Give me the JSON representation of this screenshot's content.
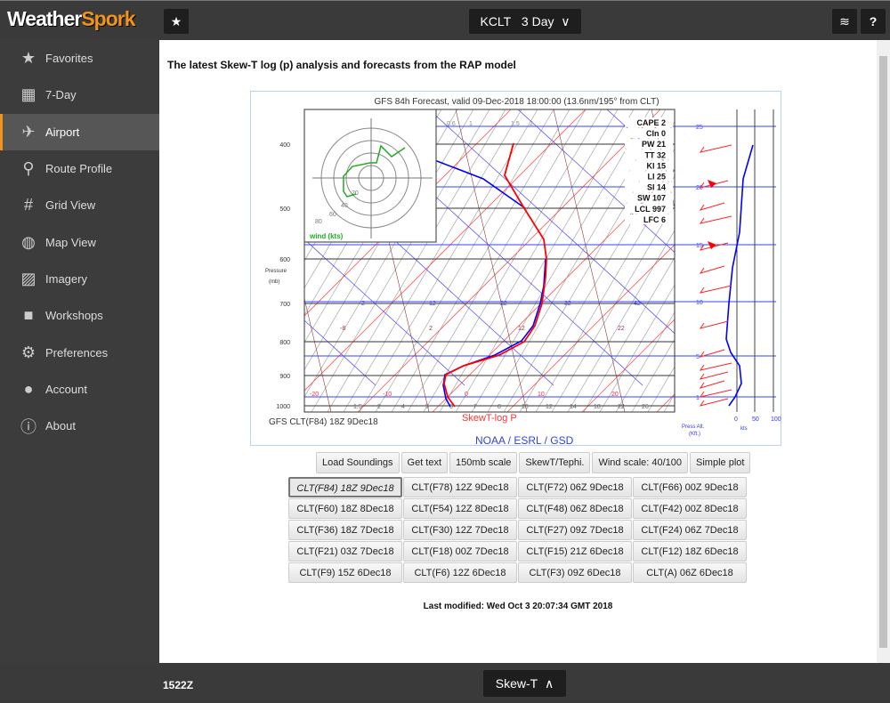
{
  "app": {
    "logo_a": "Weather",
    "logo_b": "Spork"
  },
  "topbar": {
    "station": "KCLT",
    "period": "3 Day",
    "favorite_icon": "star-icon",
    "layers_icon": "layers-icon",
    "help_icon": "help-icon"
  },
  "sidebar": {
    "items": [
      {
        "label": "Favorites",
        "icon": "star-icon",
        "glyph": "★"
      },
      {
        "label": "7-Day",
        "icon": "calendar-icon",
        "glyph": "▦"
      },
      {
        "label": "Airport",
        "icon": "plane-icon",
        "glyph": "✈",
        "active": true
      },
      {
        "label": "Route Profile",
        "icon": "route-icon",
        "glyph": "⚲"
      },
      {
        "label": "Grid View",
        "icon": "hash-icon",
        "glyph": "#"
      },
      {
        "label": "Map View",
        "icon": "globe-icon",
        "glyph": "◍"
      },
      {
        "label": "Imagery",
        "icon": "image-icon",
        "glyph": "▨"
      },
      {
        "label": "Workshops",
        "icon": "video-icon",
        "glyph": "■"
      },
      {
        "label": "Preferences",
        "icon": "gear-icon",
        "glyph": "⚙"
      },
      {
        "label": "Account",
        "icon": "user-icon",
        "glyph": "●"
      },
      {
        "label": "About",
        "icon": "info-icon",
        "glyph": "ⓘ"
      }
    ]
  },
  "main": {
    "heading": "The latest Skew-T log (p) analysis and forecasts from the RAP model",
    "plot": {
      "title": "GFS 84h Forecast, valid 09-Dec-2018 18:00:00 (13.6nm/195° from CLT)",
      "pressure_label": "Pressure",
      "pressure_unit": "(mb)",
      "pressure_ticks": [
        "400",
        "500",
        "600",
        "700",
        "800",
        "900",
        "1000"
      ],
      "stats": [
        "CAPE 2",
        "CIn 0",
        "PW 21",
        "TT 32",
        "KI 15",
        "LI 25",
        "SI 14",
        "SW 107",
        "LCL 997",
        "LFC 6"
      ],
      "hodo_label": "wind (kts)",
      "hodo_rings": [
        "20",
        "40",
        "60",
        "80"
      ],
      "mixing_ratio_ticks": [
        "0.4",
        "0.6",
        "1",
        "1.5",
        "2"
      ],
      "bottom_mix_ticks": [
        "1.5",
        "2",
        "4",
        "5",
        "6",
        "7",
        "8",
        "10",
        "12",
        "14",
        "18",
        "22",
        "26"
      ],
      "isotherm_labels": [
        "-20",
        "-10",
        "0",
        "10",
        "20"
      ],
      "theta_e_labels": [
        "2",
        "12",
        "22",
        "32",
        "42"
      ],
      "adiabat_labels": [
        "-8",
        "2",
        "12",
        "22"
      ],
      "alt_ticks": [
        "25",
        "20",
        "15",
        "10",
        "5",
        "1"
      ],
      "alt_label": "Press Alt.",
      "alt_unit": "(Kft.)",
      "speed_ticks": [
        "0",
        "50",
        "100"
      ],
      "speed_unit": "kts",
      "station_caption": "GFS CLT(F84) 18Z 9Dec18",
      "chart_kind": "SkewT-log P",
      "credit": "NOAA / ESRL / GSD",
      "colors": {
        "temperature": "#ff0000",
        "dewpoint": "#0000ff",
        "hodograph": "#00aa00"
      }
    },
    "controls": [
      "Load Soundings",
      "Get text",
      "150mb scale",
      "SkewT/Tephi.",
      "Wind scale: 40/100",
      "Simple plot"
    ],
    "soundings": [
      "CLT(F84) 18Z 9Dec18",
      "CLT(F78) 12Z 9Dec18",
      "CLT(F72) 06Z 9Dec18",
      "CLT(F66) 00Z 9Dec18",
      "CLT(F60) 18Z 8Dec18",
      "CLT(F54) 12Z 8Dec18",
      "CLT(F48) 06Z 8Dec18",
      "CLT(F42) 00Z 8Dec18",
      "CLT(F36) 18Z 7Dec18",
      "CLT(F30) 12Z 7Dec18",
      "CLT(F27) 09Z 7Dec18",
      "CLT(F24) 06Z 7Dec18",
      "CLT(F21) 03Z 7Dec18",
      "CLT(F18) 00Z 7Dec18",
      "CLT(F15) 21Z 6Dec18",
      "CLT(F12) 18Z 6Dec18",
      "CLT(F9) 15Z 6Dec18",
      "CLT(F6) 12Z 6Dec18",
      "CLT(F3) 09Z 6Dec18",
      "CLT(A) 06Z 6Dec18"
    ],
    "selected_sounding": "CLT(F84) 18Z 9Dec18",
    "last_modified": "Last modified: Wed Oct 3 20:07:34 GMT 2018"
  },
  "bottombar": {
    "time": "1522Z",
    "view": "Skew-T"
  }
}
